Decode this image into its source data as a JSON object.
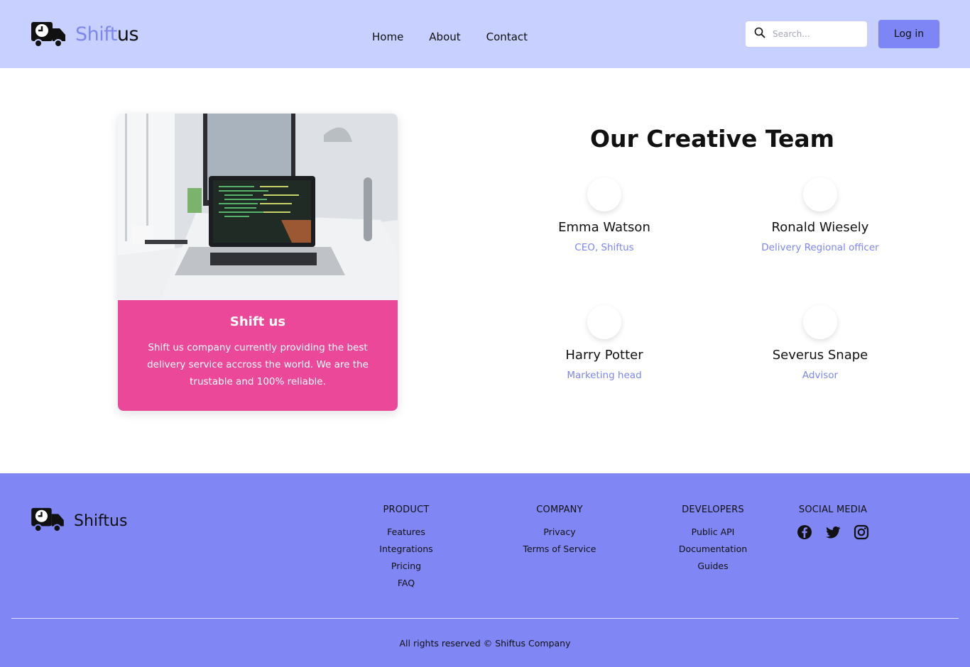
{
  "header": {
    "brand_part1": "Shift",
    "brand_part2": "us",
    "nav": [
      "Home",
      "About",
      "Contact"
    ],
    "search_placeholder": "Search...",
    "login_label": "Log in"
  },
  "card": {
    "title": "Shift us",
    "text": "Shift us company currently providing the best delivery service accross the world. We are the trustable and 100% reliable."
  },
  "team": {
    "title": "Our Creative Team",
    "members": [
      {
        "name": "Emma Watson",
        "role": "CEO, Shiftus"
      },
      {
        "name": "Ronald Wiesely",
        "role": "Delivery Regional officer"
      },
      {
        "name": "Harry Potter",
        "role": "Marketing head"
      },
      {
        "name": "Severus Snape",
        "role": "Advisor"
      }
    ]
  },
  "footer": {
    "brand": "Shiftus",
    "columns": [
      {
        "title": "PRODUCT",
        "links": [
          "Features",
          "Integrations",
          "Pricing",
          "FAQ"
        ]
      },
      {
        "title": "COMPANY",
        "links": [
          "Privacy",
          "Terms of Service"
        ]
      },
      {
        "title": "DEVELOPERS",
        "links": [
          "Public API",
          "Documentation",
          "Guides"
        ]
      }
    ],
    "social_title": "SOCIAL MEDIA",
    "social_icons": [
      "facebook-icon",
      "twitter-icon",
      "instagram-icon"
    ],
    "copyright": "All rights reserved © Shiftus Company"
  },
  "colors": {
    "header_bg": "#c7d0fe",
    "accent": "#7d86f4",
    "card_bg": "#ec4899",
    "footer_bg": "#8087f5"
  }
}
